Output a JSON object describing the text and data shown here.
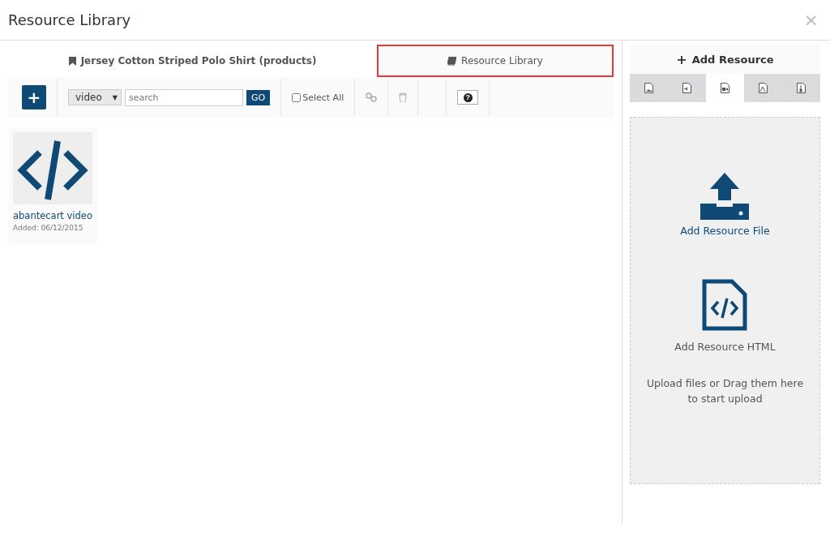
{
  "window": {
    "title": "Resource Library",
    "close": "×"
  },
  "tabs": [
    {
      "label": "Jersey Cotton Striped Polo Shirt (products)",
      "selected": true,
      "highlighted": false
    },
    {
      "label": "Resource Library",
      "selected": false,
      "highlighted": true
    }
  ],
  "toolbar": {
    "add": "+",
    "type_select": "video",
    "type_caret": "▼",
    "search": {
      "placeholder": "search"
    },
    "go": "GO",
    "select_all": {
      "label": "Select All",
      "checked": false
    },
    "help": "?"
  },
  "resources": [
    {
      "title": "abantecart video",
      "added": "Added: 06/12/2015"
    }
  ],
  "add_panel": {
    "plus": "+",
    "title": "Add Resource",
    "type_tabs": [
      {
        "kind": "image",
        "selected": false
      },
      {
        "kind": "audio",
        "selected": false
      },
      {
        "kind": "video",
        "selected": true
      },
      {
        "kind": "pdf",
        "selected": false
      },
      {
        "kind": "archive",
        "selected": false
      }
    ],
    "file_label": "Add Resource File",
    "html_label": "Add Resource HTML",
    "hint": "Upload files or Drag them here to start upload"
  }
}
